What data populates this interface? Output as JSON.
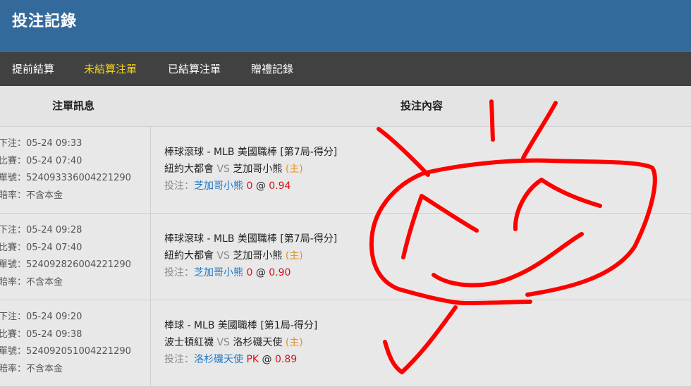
{
  "header": {
    "title": "投注記錄"
  },
  "tabs": [
    {
      "label": "提前結算",
      "active": false
    },
    {
      "label": "未結算注單",
      "active": true
    },
    {
      "label": "已結算注單",
      "active": false
    },
    {
      "label": "贈禮記錄",
      "active": false
    }
  ],
  "table": {
    "headers": {
      "info": "注單訊息",
      "content": "投注內容"
    },
    "rows": [
      {
        "bet_time": "下注：05-24 09:33",
        "match_time": "比賽：05-24 07:40",
        "ticket_no": "單號：524093336004221290",
        "odds_type": "賠率：不含本金",
        "league": "棒球滾球 - MLB 美國職棒 [第7局-得分]",
        "home": "紐約大都會",
        "vs": "VS",
        "away": "芝加哥小熊",
        "home_tag": "(主)",
        "pick_label": "投注：",
        "pick": "芝加哥小熊",
        "line": "0",
        "at": "@",
        "odds": "0.94"
      },
      {
        "bet_time": "下注：05-24 09:28",
        "match_time": "比賽：05-24 07:40",
        "ticket_no": "單號：524092826004221290",
        "odds_type": "賠率：不含本金",
        "league": "棒球滾球 - MLB 美國職棒 [第7局-得分]",
        "home": "紐約大都會",
        "vs": "VS",
        "away": "芝加哥小熊",
        "home_tag": "(主)",
        "pick_label": "投注：",
        "pick": "芝加哥小熊",
        "line": "0",
        "at": "@",
        "odds": "0.90"
      },
      {
        "bet_time": "下注：05-24 09:20",
        "match_time": "比賽：05-24 09:38",
        "ticket_no": "單號：524092051004221290",
        "odds_type": "賠率：不含本金",
        "league": "棒球 - MLB 美國職棒 [第1局-得分]",
        "home": "波士頓紅襪",
        "vs": "VS",
        "away": "洛杉磯天使",
        "home_tag": "(主)",
        "pick_label": "投注：",
        "pick": "洛杉磯天使",
        "line": "PK",
        "at": "@",
        "odds": "0.89"
      }
    ]
  },
  "colors": {
    "header_bg": "#346a9b",
    "tab_bar_bg": "#414141",
    "active_tab": "#f3d21b",
    "pick_blue": "#1f78c8",
    "odds_red": "#d4121b",
    "home_tag_orange": "#e5922e",
    "scribble_red": "#ff0000"
  }
}
